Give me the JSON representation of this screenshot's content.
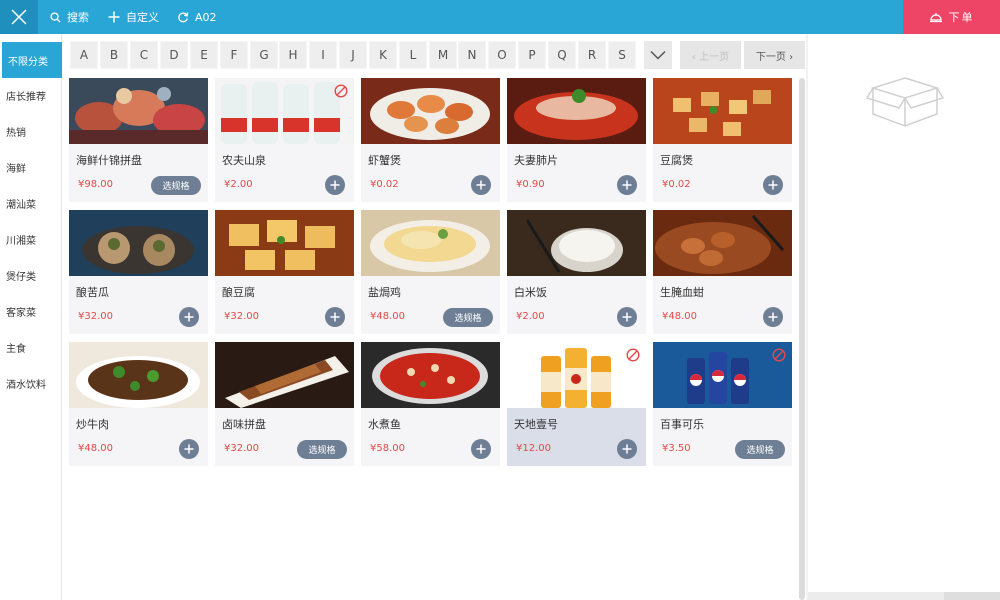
{
  "topbar": {
    "search_label": "搜索",
    "custom_label": "自定义",
    "table_label": "A02",
    "order_label": "下单"
  },
  "sidebar": {
    "categories": [
      {
        "label": "不限分类",
        "active": true
      },
      {
        "label": "店长推荐"
      },
      {
        "label": "热销"
      },
      {
        "label": "海鲜"
      },
      {
        "label": "潮汕菜"
      },
      {
        "label": "川湘菜"
      },
      {
        "label": "煲仔类"
      },
      {
        "label": "客家菜"
      },
      {
        "label": "主食"
      },
      {
        "label": "酒水饮料"
      }
    ]
  },
  "letters": [
    "A",
    "B",
    "C",
    "D",
    "E",
    "F",
    "G",
    "H",
    "I",
    "J",
    "K",
    "L",
    "M",
    "N",
    "O",
    "P",
    "Q",
    "R",
    "S"
  ],
  "pagination": {
    "prev": "‹ 上一页",
    "next": "下一页 ›"
  },
  "dishes": [
    {
      "name": "海鲜什锦拼盘",
      "price": "¥98.00",
      "action": "选规格"
    },
    {
      "name": "农夫山泉",
      "price": "¥2.00",
      "action": "+",
      "unavailable": true
    },
    {
      "name": "虾蟹煲",
      "price": "¥0.02",
      "action": "+",
      "unavailable": true
    },
    {
      "name": "夫妻肺片",
      "price": "¥0.90",
      "action": "+"
    },
    {
      "name": "豆腐煲",
      "price": "¥0.02",
      "action": "+"
    },
    {
      "name": "酿苦瓜",
      "price": "¥32.00",
      "action": "+"
    },
    {
      "name": "酿豆腐",
      "price": "¥32.00",
      "action": "+"
    },
    {
      "name": "盐焗鸡",
      "price": "¥48.00",
      "action": "选规格"
    },
    {
      "name": "白米饭",
      "price": "¥2.00",
      "action": "+"
    },
    {
      "name": "生腌血蚶",
      "price": "¥48.00",
      "action": "+"
    },
    {
      "name": "炒牛肉",
      "price": "¥48.00",
      "action": "+"
    },
    {
      "name": "卤味拼盘",
      "price": "¥32.00",
      "action": "选规格"
    },
    {
      "name": "水煮鱼",
      "price": "¥58.00",
      "action": "+"
    },
    {
      "name": "天地壹号",
      "price": "¥12.00",
      "action": "+",
      "unavailable": true,
      "highlight": true
    },
    {
      "name": "百事可乐",
      "price": "¥3.50",
      "action": "选规格",
      "unavailable": true
    }
  ],
  "colors": {
    "accent": "#2aa6d6",
    "order": "#ee4466",
    "price": "#e24a4a",
    "button": "#6e7f95"
  }
}
